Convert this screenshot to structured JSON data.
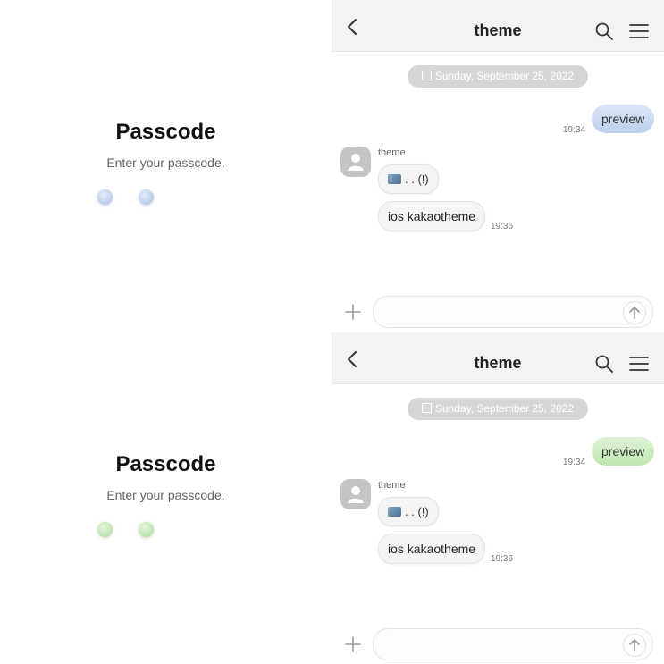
{
  "colors": {
    "blue_accent": "#c8d8f2",
    "green_accent": "#c9ecbd"
  },
  "screens": [
    {
      "theme": "blue",
      "passcode": {
        "title": "Passcode",
        "subtitle": "Enter your passcode."
      },
      "chat": {
        "header_title": "theme",
        "date": "Sunday, September 25, 2022",
        "sent": {
          "text": "preview",
          "time": "19:34"
        },
        "sender_name": "theme",
        "received": [
          {
            "text": ". . (!)"
          },
          {
            "text": "ios kakaotheme"
          }
        ],
        "received_time": "19:36"
      }
    },
    {
      "theme": "green",
      "passcode": {
        "title": "Passcode",
        "subtitle": "Enter your passcode."
      },
      "chat": {
        "header_title": "theme",
        "date": "Sunday, September 25, 2022",
        "sent": {
          "text": "preview",
          "time": "19:34"
        },
        "sender_name": "theme",
        "received": [
          {
            "text": ". . (!)"
          },
          {
            "text": "ios kakaotheme"
          }
        ],
        "received_time": "19:36"
      }
    }
  ]
}
